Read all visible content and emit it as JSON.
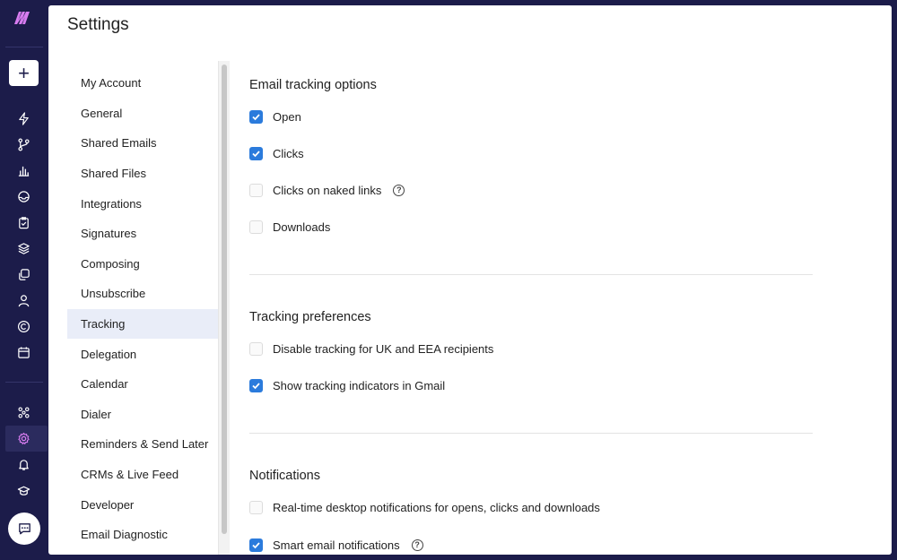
{
  "rail": {
    "icons": [
      "bolt-icon",
      "branch-icon",
      "bar-chart-icon",
      "inbox-icon",
      "clipboard-check-icon",
      "layers-icon",
      "copy-icon",
      "user-icon",
      "copyright-icon",
      "calendar-icon",
      "network-icon",
      "gear-icon",
      "bell-icon",
      "graduation-cap-icon"
    ],
    "new_button": "+",
    "chat": "chat-icon"
  },
  "page": {
    "title": "Settings"
  },
  "nav": {
    "items": [
      {
        "label": "My Account"
      },
      {
        "label": "General"
      },
      {
        "label": "Shared Emails"
      },
      {
        "label": "Shared Files"
      },
      {
        "label": "Integrations"
      },
      {
        "label": "Signatures"
      },
      {
        "label": "Composing"
      },
      {
        "label": "Unsubscribe"
      },
      {
        "label": "Tracking",
        "active": true
      },
      {
        "label": "Delegation"
      },
      {
        "label": "Calendar"
      },
      {
        "label": "Dialer"
      },
      {
        "label": "Reminders & Send Later"
      },
      {
        "label": "CRMs & Live Feed"
      },
      {
        "label": "Developer"
      },
      {
        "label": "Email Diagnostic"
      }
    ]
  },
  "sections": {
    "email_tracking": {
      "title": "Email tracking options",
      "options": [
        {
          "label": "Open",
          "checked": true
        },
        {
          "label": "Clicks",
          "checked": true
        },
        {
          "label": "Clicks on naked links",
          "checked": false,
          "help": "?"
        },
        {
          "label": "Downloads",
          "checked": false
        }
      ]
    },
    "tracking_prefs": {
      "title": "Tracking preferences",
      "options": [
        {
          "label": "Disable tracking for UK and EEA recipients",
          "checked": false
        },
        {
          "label": "Show tracking indicators in Gmail",
          "checked": true
        }
      ]
    },
    "notifications": {
      "title": "Notifications",
      "options": [
        {
          "label": "Real-time desktop notifications for opens, clicks and downloads",
          "checked": false
        },
        {
          "label": "Smart email notifications",
          "checked": true,
          "help": "?"
        }
      ]
    }
  },
  "colors": {
    "rail_bg": "#1c1c4a",
    "checkbox_on": "#2b7bdc",
    "nav_active_bg": "#e9edf8",
    "logo": "#d77cf0"
  }
}
